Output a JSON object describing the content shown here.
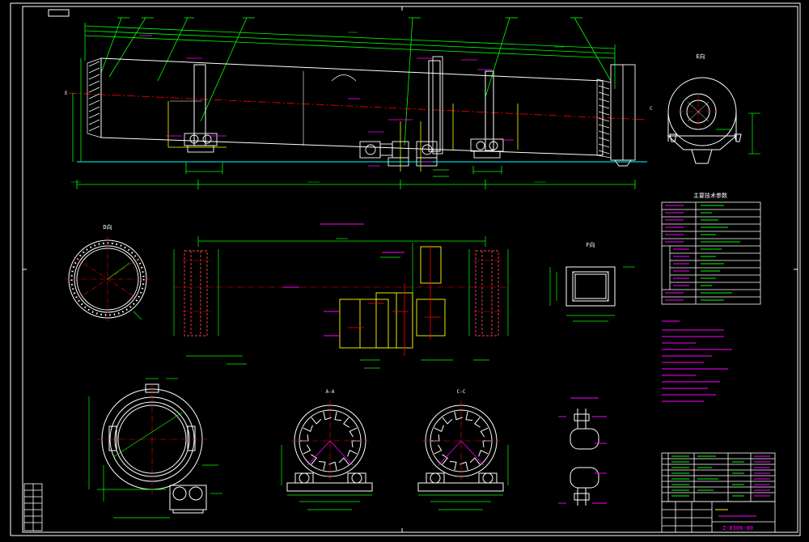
{
  "drawing": {
    "view_labels": {
      "e_view": "E向",
      "d_view": "D向",
      "f_view": "F向",
      "section_aa": "A-A",
      "section_cc": "C-C"
    },
    "section_letters": [
      "A",
      "C",
      "E",
      "F"
    ],
    "params_table_title": "主要技术参数",
    "title_block_code": "Z-0306-00",
    "colors": {
      "background": "#000000",
      "frame": "#ffffff",
      "outline": "#ffffff",
      "dimension": "#00ff00",
      "centerline": "#ff0000",
      "annotation": "#ff00ff",
      "hidden": "#ffff00",
      "ground": "#00ffff"
    }
  }
}
